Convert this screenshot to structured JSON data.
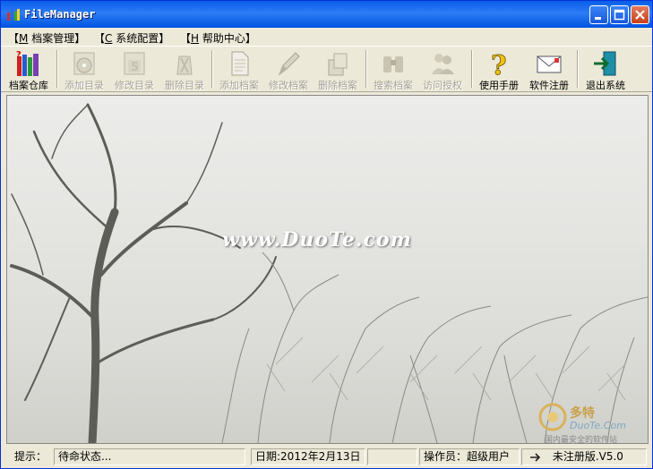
{
  "window": {
    "title": "FileManager"
  },
  "menu": [
    {
      "key": "M",
      "label": "档案管理"
    },
    {
      "key": "C",
      "label": "系统配置"
    },
    {
      "key": "H",
      "label": "帮助中心"
    }
  ],
  "toolbar": [
    {
      "label": "档案仓库",
      "icon": "archive-warehouse-icon",
      "enabled": true
    },
    {
      "label": "添加目录",
      "icon": "add-catalog-icon",
      "enabled": false
    },
    {
      "label": "修改目录",
      "icon": "edit-catalog-icon",
      "enabled": false
    },
    {
      "label": "删除目录",
      "icon": "delete-catalog-icon",
      "enabled": false
    },
    {
      "label": "添加档案",
      "icon": "add-file-icon",
      "enabled": false
    },
    {
      "label": "修改档案",
      "icon": "edit-file-icon",
      "enabled": false
    },
    {
      "label": "删除档案",
      "icon": "delete-file-icon",
      "enabled": false
    },
    {
      "label": "搜索档案",
      "icon": "binoculars-icon",
      "enabled": false
    },
    {
      "label": "访问授权",
      "icon": "access-users-icon",
      "enabled": false
    },
    {
      "label": "使用手册",
      "icon": "help-question-icon",
      "enabled": true
    },
    {
      "label": "软件注册",
      "icon": "register-envelope-icon",
      "enabled": true
    },
    {
      "label": "退出系统",
      "icon": "exit-door-icon",
      "enabled": true
    }
  ],
  "content": {
    "watermark": "www.DuoTe.com",
    "logo_cn": "多特",
    "logo_en": "DuoTe.Com",
    "logo_tagline": "国内最安全的软件站"
  },
  "status": {
    "hint_label": "提示：",
    "state": "待命状态...",
    "date": "日期:2012年2月13日",
    "operator": "操作员：超级用户",
    "version": "未注册版.V5.0"
  },
  "colors": {
    "title_bar": "#0A5FE8",
    "window_bg": "#ECE9D8",
    "disabled_text": "#a5a196"
  }
}
